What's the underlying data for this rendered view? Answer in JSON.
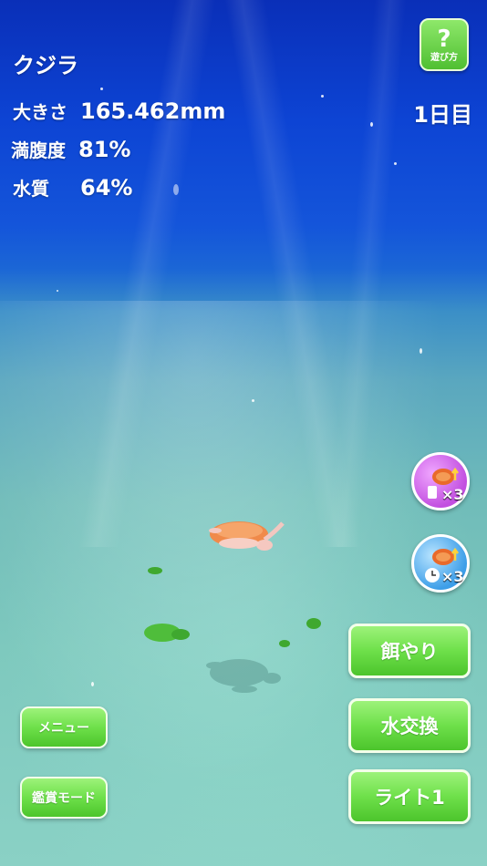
{
  "species": "クジラ",
  "stats": {
    "size_label": "大きさ",
    "size_value": "165.462mm",
    "fullness_label": "満腹度",
    "fullness_value": "81%",
    "water_label": "水質",
    "water_value": "64%"
  },
  "day": "1日目",
  "help": {
    "icon": "?",
    "label": "遊び方"
  },
  "boosts": [
    {
      "icon": "turtle-tap-boost-icon",
      "multiplier": "×3",
      "color": "#c24fe0"
    },
    {
      "icon": "turtle-time-boost-icon",
      "multiplier": "×3",
      "color": "#3d9ee8"
    }
  ],
  "actions": {
    "feed": "餌やり",
    "water_change": "水交換",
    "light": "ライト1"
  },
  "menu": {
    "menu": "メニュー",
    "viewing_mode": "鑑賞モード"
  }
}
